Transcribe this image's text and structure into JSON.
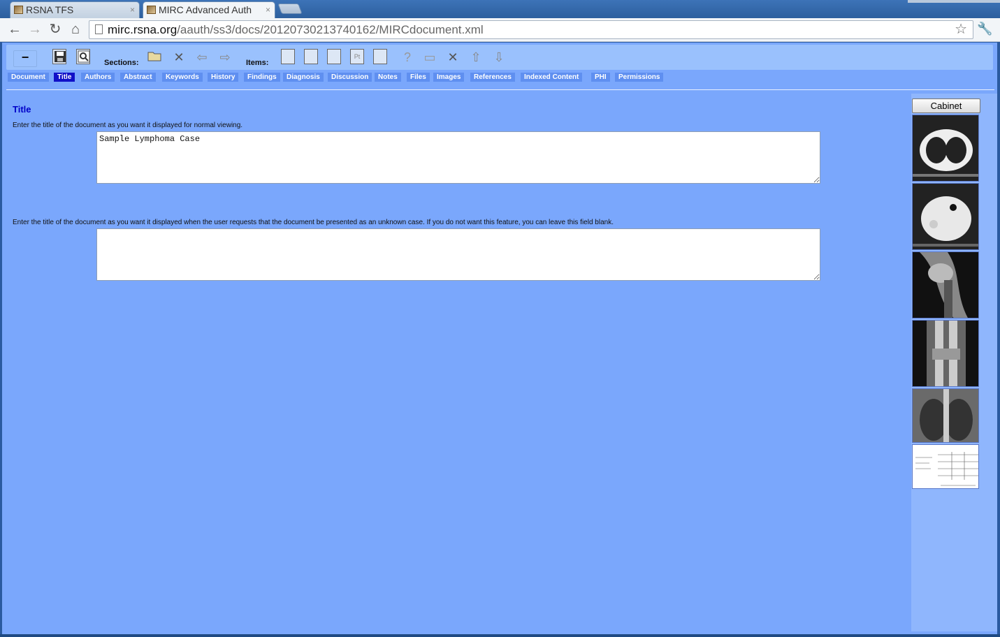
{
  "browser": {
    "tabs": [
      {
        "title": "RSNA TFS",
        "active": false
      },
      {
        "title": "MIRC Advanced Auth",
        "active": true
      }
    ],
    "url_host": "mirc.rsna.org",
    "url_path": "/aauth/ss3/docs/20120730213740162/MIRCdocument.xml"
  },
  "editor": {
    "minus_label": "−",
    "sections_label": "Sections:",
    "items_label": "Items:",
    "section_tabs": [
      {
        "label": "Document",
        "selected": false
      },
      {
        "label": "Title",
        "selected": true
      },
      {
        "label": "Authors",
        "selected": false
      },
      {
        "label": "Abstract",
        "selected": false
      },
      {
        "label": "Keywords",
        "selected": false
      },
      {
        "label": "History",
        "selected": false
      },
      {
        "label": "Findings",
        "selected": false
      },
      {
        "label": "Diagnosis",
        "selected": false
      },
      {
        "label": "Discussion",
        "selected": false
      },
      {
        "label": "Notes",
        "selected": false
      },
      {
        "label": "Files",
        "selected": false
      },
      {
        "label": "Images",
        "selected": false
      },
      {
        "label": "References",
        "selected": false
      },
      {
        "label": "Indexed Content",
        "selected": false
      },
      {
        "label": "PHI",
        "selected": false
      },
      {
        "label": "Permissions",
        "selected": false
      }
    ],
    "section": {
      "title": "Title",
      "help1": "Enter the title of the document as you want it displayed for normal viewing.",
      "title_value": "Sample Lymphoma Case",
      "help2": "Enter the title of the document as you want it displayed when the user requests that the document be presented as an unknown case. If you do not want this feature, you can leave this field blank.",
      "alt_title_value": ""
    }
  },
  "cabinet": {
    "button_label": "Cabinet"
  },
  "colors": {
    "page_bg": "#7aa7fc",
    "selected_tab": "#1010c8",
    "title_text": "#0000c8"
  }
}
